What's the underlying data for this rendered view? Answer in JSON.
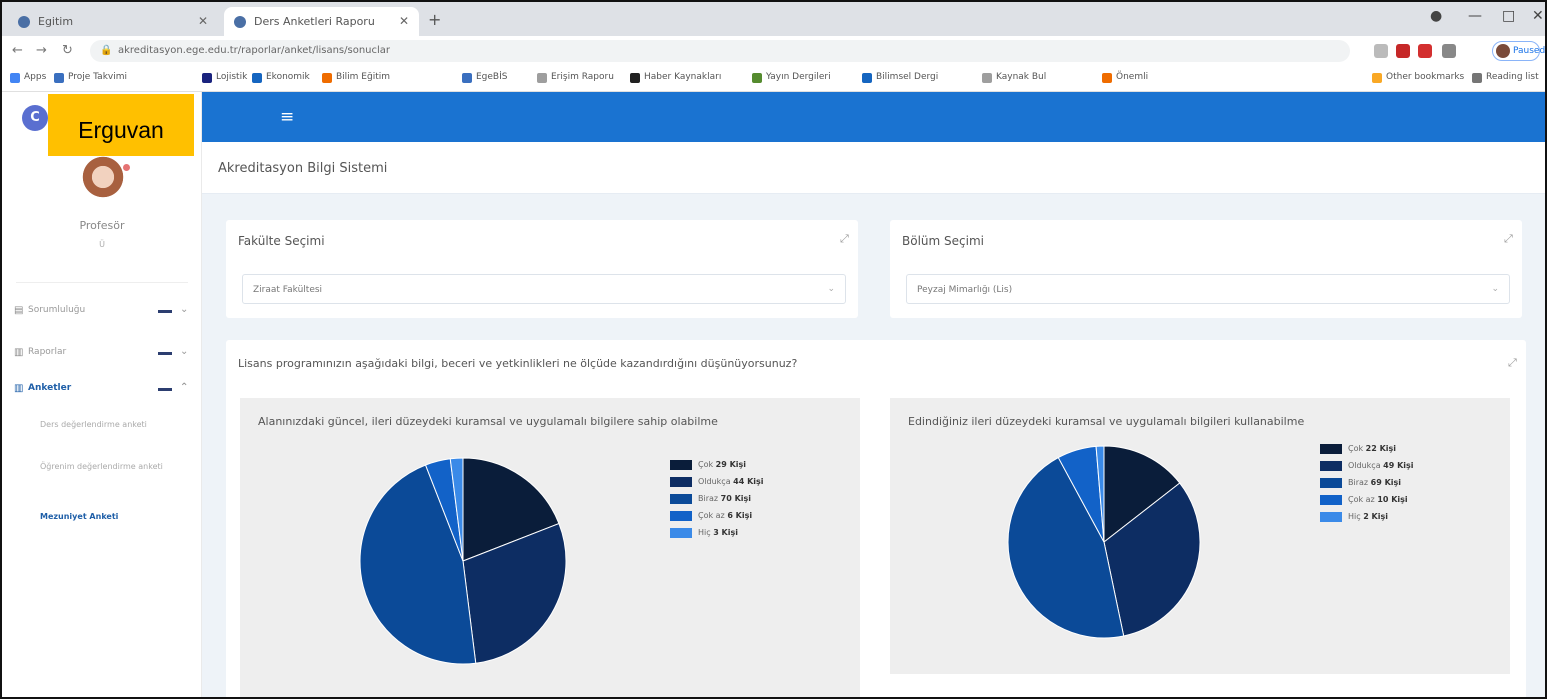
{
  "browser": {
    "tabs": [
      {
        "title": "Egitim",
        "active": false
      },
      {
        "title": "Ders Anketleri Raporu",
        "active": true
      }
    ],
    "address": "akreditasyon.ege.edu.tr/raporlar/anket/lisans/sonuclar",
    "profile_label": "Paused",
    "bookmarks": [
      "Apps",
      "Proje Takvimi",
      "Lojistik",
      "Ekonomik",
      "Bilim Eğitim",
      "EgeBİS",
      "Erişim Raporu",
      "Haber Kaynakları",
      "Yayın Dergileri",
      "Bilimsel Dergi",
      "Kaynak Bul",
      "Önemli",
      "Other bookmarks",
      "Reading list"
    ],
    "colors": {
      "tabstrip": "#dee1e6",
      "toolbar": "#ffffff"
    }
  },
  "sidebar": {
    "brand_label": "Erguvan",
    "user_name": "Profesör",
    "user_sub": "Ü",
    "menu": [
      {
        "label": "Sorumluluğu",
        "icon": "file-icon",
        "active": false
      },
      {
        "label": "Raporlar",
        "icon": "chart-icon",
        "active": false
      },
      {
        "label": "Anketler",
        "icon": "survey-icon",
        "active": true
      }
    ],
    "submenu": [
      {
        "label": "Ders değerlendirme anketi",
        "active": false
      },
      {
        "label": "Öğrenim değerlendirme anketi",
        "active": false
      },
      {
        "label": "Mezuniyet Anketi",
        "active": true
      }
    ]
  },
  "header": {
    "page_title": "Akreditasyon Bilgi Sistemi",
    "accent_color": "#1a73d1"
  },
  "filters": {
    "faculty": {
      "title": "Fakülte Seçimi",
      "value": "Ziraat Fakültesi"
    },
    "department": {
      "title": "Bölüm Seçimi",
      "value": "Peyzaj Mimarlığı (Lis)"
    }
  },
  "question": "Lisans programınızın aşağıdaki bilgi, beceri ve yetkinlikleri ne ölçüde kazandırdığını düşünüyorsunuz?",
  "chart_data": [
    {
      "type": "pie",
      "title": "Alanınızdaki güncel, ileri düzeydeki kuramsal ve uygulamalı bilgilere sahip olabilme",
      "labels": [
        "Çok",
        "Oldukça",
        "Biraz",
        "Çok az",
        "Hiç"
      ],
      "values": [
        29,
        44,
        70,
        6,
        3
      ],
      "legend_text": [
        "Çok 29 Kişi",
        "Oldukça 44 Kişi",
        "Biraz 70 Kişi",
        "Çok az 6 Kişi",
        "Hiç 3 Kişi"
      ],
      "colors": [
        "#0a1d3a",
        "#0d2d63",
        "#0b4a98",
        "#1262c8",
        "#3a8ae8"
      ],
      "legend_position": "right"
    },
    {
      "type": "pie",
      "title": "Edindiğiniz ileri düzeydeki kuramsal ve uygulamalı bilgileri kullanabilme",
      "labels": [
        "Çok",
        "Oldukça",
        "Biraz",
        "Çok az",
        "Hiç"
      ],
      "values": [
        22,
        49,
        69,
        10,
        2
      ],
      "legend_text": [
        "Çok 22 Kişi",
        "Oldukça 49 Kişi",
        "Biraz 69 Kişi",
        "Çok az 10 Kişi",
        "Hiç 2 Kişi"
      ],
      "colors": [
        "#0a1d3a",
        "#0d2d63",
        "#0b4a98",
        "#1262c8",
        "#3a8ae8"
      ],
      "legend_position": "right"
    }
  ]
}
